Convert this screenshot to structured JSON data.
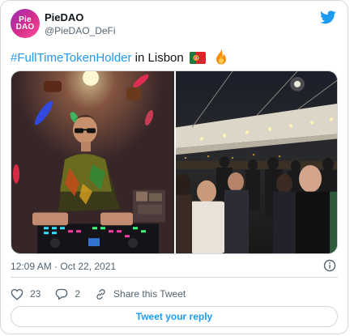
{
  "author": {
    "avatar_text": "Pie\nDAO",
    "name": "PieDAO",
    "handle": "@PieDAO_DeFi"
  },
  "tweet": {
    "hashtag": "#FullTimeTokenHolder",
    "text": " in Lisbon",
    "emoji": [
      "portugal-flag",
      "fire"
    ]
  },
  "media": {
    "photos": [
      {
        "subject": "dj-at-turntables"
      },
      {
        "subject": "rooftop-party-crowd"
      }
    ]
  },
  "timestamp": "12:09 AM · Oct 22, 2021",
  "actions": {
    "like_count": "23",
    "reply_count": "2",
    "share_label": "Share this Tweet"
  },
  "reply_button_label": "Tweet your reply",
  "colors": {
    "accent": "#1d9bf0",
    "secondary_text": "#536471",
    "border": "#cfd9de"
  }
}
